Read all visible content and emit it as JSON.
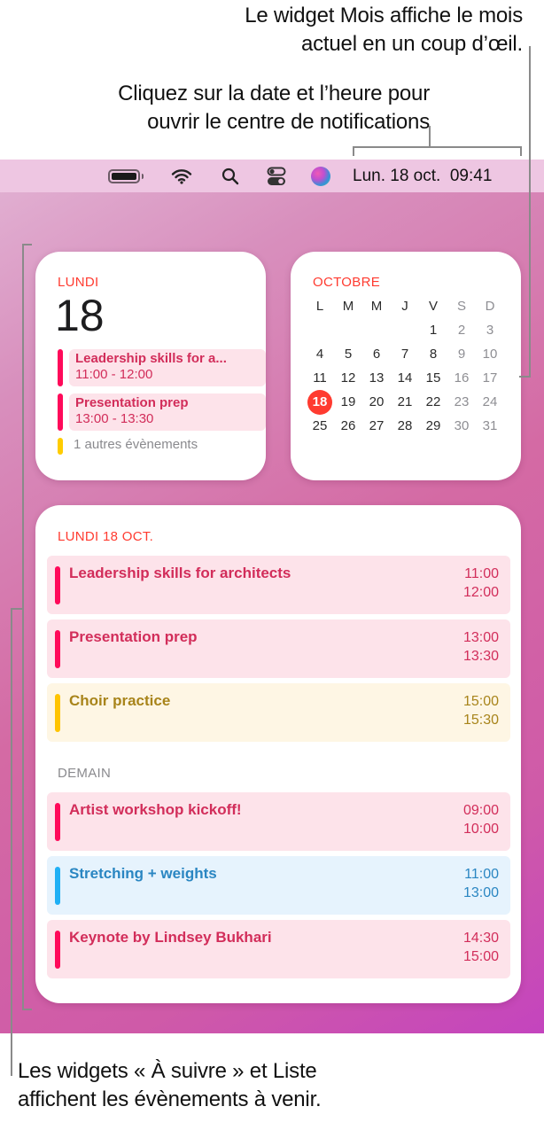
{
  "callouts": {
    "month_widget": [
      "Le widget Mois affiche le mois",
      "actuel en un coup d’œil."
    ],
    "date_time": [
      "Cliquez sur la date et l’heure pour",
      "ouvrir le centre de notifications"
    ],
    "widgets": [
      "Les widgets « À suivre » et Liste",
      "affichent les évènements à venir."
    ]
  },
  "menubar": {
    "icons": [
      "battery-icon",
      "wifi-icon",
      "spotlight-search-icon",
      "control-center-icon",
      "siri-icon"
    ],
    "clock": "Lun. 18 oct.  09:41"
  },
  "up_next_widget": {
    "day_name": "LUNDI",
    "day_number": "18",
    "events": [
      {
        "title": "Leadership skills for a...",
        "time": "11:00 - 12:00",
        "color": "#ff0a5a"
      },
      {
        "title": "Presentation prep",
        "time": "13:00 - 13:30",
        "color": "#ff0a5a"
      }
    ],
    "more": {
      "label": "1 autres évènements",
      "color": "#ffcc00"
    }
  },
  "month_widget": {
    "month": "OCTOBRE",
    "weekdays": [
      "L",
      "M",
      "M",
      "J",
      "V",
      "S",
      "D"
    ],
    "weeks": [
      [
        "",
        "",
        "",
        "",
        "1",
        "2",
        "3"
      ],
      [
        "4",
        "5",
        "6",
        "7",
        "8",
        "9",
        "10"
      ],
      [
        "11",
        "12",
        "13",
        "14",
        "15",
        "16",
        "17"
      ],
      [
        "18",
        "19",
        "20",
        "21",
        "22",
        "23",
        "24"
      ],
      [
        "25",
        "26",
        "27",
        "28",
        "29",
        "30",
        "31"
      ]
    ],
    "today": "18",
    "today_color": "#ff3b30"
  },
  "list_widget": {
    "today_label": "LUNDI 18 OCT.",
    "tomorrow_label": "DEMAIN",
    "today_events": [
      {
        "title": "Leadership skills for architects",
        "start": "11:00",
        "end": "12:00",
        "calendar": "pink"
      },
      {
        "title": "Presentation prep",
        "start": "13:00",
        "end": "13:30",
        "calendar": "pink"
      },
      {
        "title": "Choir practice",
        "start": "15:00",
        "end": "15:30",
        "calendar": "yellow"
      }
    ],
    "tomorrow_events": [
      {
        "title": "Artist workshop kickoff!",
        "start": "09:00",
        "end": "10:00",
        "calendar": "pink"
      },
      {
        "title": "Stretching + weights",
        "start": "11:00",
        "end": "13:00",
        "calendar": "blue"
      },
      {
        "title": "Keynote by Lindsey Bukhari",
        "start": "14:30",
        "end": "15:00",
        "calendar": "pink"
      }
    ]
  },
  "colors": {
    "accent_red": "#ff3b30",
    "event_pink": "#ff0a5a",
    "event_yellow": "#ffc400",
    "event_blue": "#1fb0f5"
  }
}
